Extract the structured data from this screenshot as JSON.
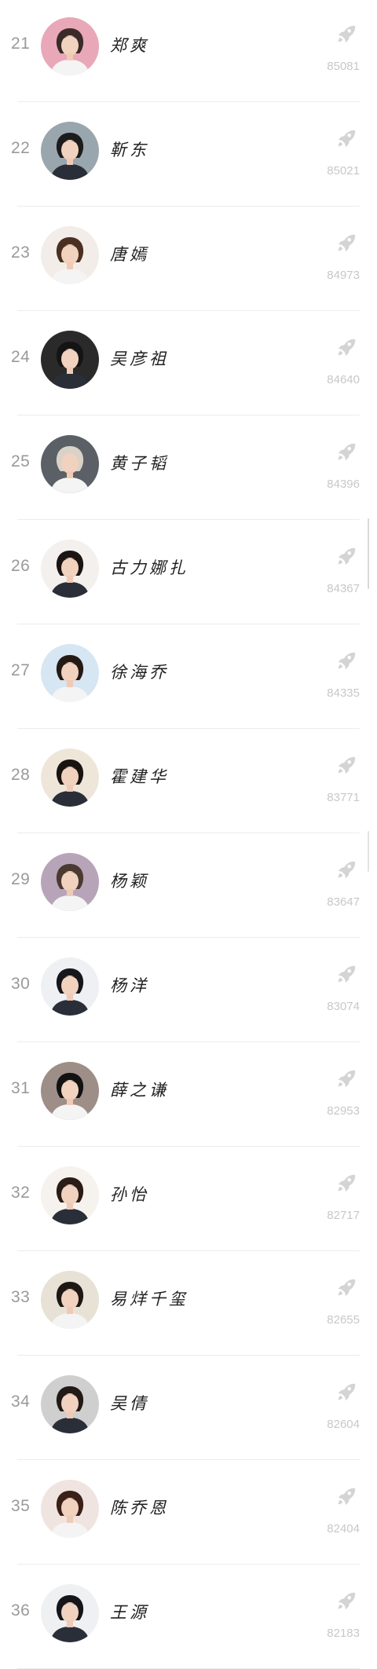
{
  "ranking": {
    "items": [
      {
        "rank": "21",
        "name": "郑爽",
        "score": "85081",
        "avatar_color": "#e8a8b8",
        "hair_color": "#3a2a28"
      },
      {
        "rank": "22",
        "name": "靳东",
        "score": "85021",
        "avatar_color": "#9aa6ae",
        "hair_color": "#1c1c1c"
      },
      {
        "rank": "23",
        "name": "唐嫣",
        "score": "84973",
        "avatar_color": "#f2ede8",
        "hair_color": "#4a3022"
      },
      {
        "rank": "24",
        "name": "吴彦祖",
        "score": "84640",
        "avatar_color": "#2a2a2a",
        "hair_color": "#141414"
      },
      {
        "rank": "25",
        "name": "黄子韬",
        "score": "84396",
        "avatar_color": "#5a6066",
        "hair_color": "#d9d2c8"
      },
      {
        "rank": "26",
        "name": "古力娜扎",
        "score": "84367",
        "avatar_color": "#f4f0ee",
        "hair_color": "#1a1412"
      },
      {
        "rank": "27",
        "name": "徐海乔",
        "score": "84335",
        "avatar_color": "#d6e6f2",
        "hair_color": "#241a14"
      },
      {
        "rank": "28",
        "name": "霍建华",
        "score": "83771",
        "avatar_color": "#efe6da",
        "hair_color": "#1a1410"
      },
      {
        "rank": "29",
        "name": "杨颖",
        "score": "83647",
        "avatar_color": "#b8a4b8",
        "hair_color": "#4a3a30"
      },
      {
        "rank": "30",
        "name": "杨洋",
        "score": "83074",
        "avatar_color": "#eef0f4",
        "hair_color": "#16161c"
      },
      {
        "rank": "31",
        "name": "薛之谦",
        "score": "82953",
        "avatar_color": "#9e8e88",
        "hair_color": "#121212"
      },
      {
        "rank": "32",
        "name": "孙怡",
        "score": "82717",
        "avatar_color": "#f6f2ee",
        "hair_color": "#2a1c16"
      },
      {
        "rank": "33",
        "name": "易烊千玺",
        "score": "82655",
        "avatar_color": "#e8e2d6",
        "hair_color": "#1e1814"
      },
      {
        "rank": "34",
        "name": "吴倩",
        "score": "82604",
        "avatar_color": "#cfcfcf",
        "hair_color": "#221a16"
      },
      {
        "rank": "35",
        "name": "陈乔恩",
        "score": "82404",
        "avatar_color": "#f0e4e0",
        "hair_color": "#3a2018"
      },
      {
        "rank": "36",
        "name": "王源",
        "score": "82183",
        "avatar_color": "#eef0f2",
        "hair_color": "#15151a"
      }
    ]
  },
  "icons": {
    "vote": "rocket-icon"
  },
  "colors": {
    "rank_text": "#9a9a9a",
    "score_text": "#c8c8c8",
    "icon_gray": "#d4d4d4",
    "divider": "#ececec"
  }
}
